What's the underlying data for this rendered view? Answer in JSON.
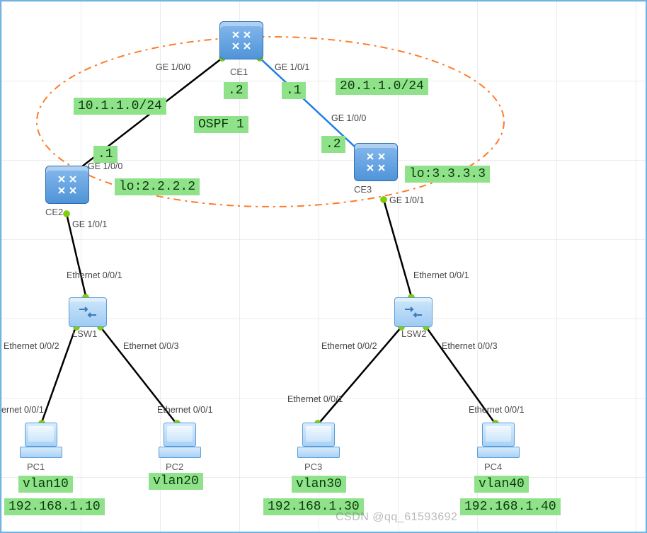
{
  "routers": {
    "ce1": {
      "label": "CE1"
    },
    "ce2": {
      "label": "CE2"
    },
    "ce3": {
      "label": "CE3"
    }
  },
  "switches": {
    "lsw1": {
      "label": "LSW1"
    },
    "lsw2": {
      "label": "LSW2"
    }
  },
  "pcs": {
    "pc1": {
      "label": "PC1",
      "vlan": "vlan10",
      "ip": "192.168.1.10"
    },
    "pc2": {
      "label": "PC2",
      "vlan": "vlan20"
    },
    "pc3": {
      "label": "PC3",
      "vlan": "vlan30",
      "ip": "192.168.1.30"
    },
    "pc4": {
      "label": "PC4",
      "vlan": "vlan40",
      "ip": "192.168.1.40"
    }
  },
  "subnets": {
    "left": "10.1.1.0/24",
    "right": "20.1.1.0/24"
  },
  "loopbacks": {
    "ce2": "lo:2.2.2.2",
    "ce3": "lo:3.3.3.3"
  },
  "routing": {
    "area": "OSPF 1"
  },
  "ip_frag": {
    "ce1_left": ".2",
    "ce1_right": ".1",
    "ce2": ".1",
    "ce3": ".2"
  },
  "ports": {
    "ge100": "GE 1/0/0",
    "ge101": "GE 1/0/1",
    "eth001": "Ethernet 0/0/1",
    "eth002": "Ethernet 0/0/2",
    "eth003": "Ethernet 0/0/3",
    "eth001_trunc": "ernet 0/0/1"
  },
  "watermark": "CSDN @qq_61593692"
}
